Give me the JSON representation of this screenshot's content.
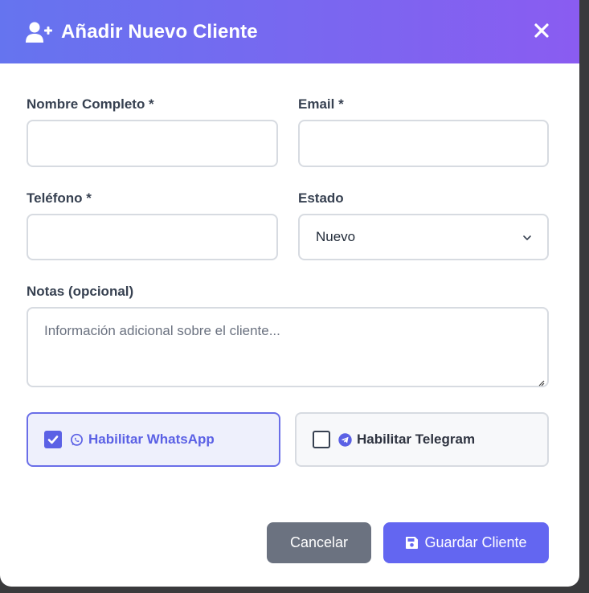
{
  "modal": {
    "title": "Añadir Nuevo Cliente",
    "header_icon": "user-plus-icon",
    "close_icon": "close-icon"
  },
  "form": {
    "name": {
      "label": "Nombre Completo *",
      "value": ""
    },
    "email": {
      "label": "Email *",
      "value": ""
    },
    "phone": {
      "label": "Teléfono *",
      "value": ""
    },
    "status": {
      "label": "Estado",
      "selected": "Nuevo",
      "icon": "chevron-down-icon"
    },
    "notes": {
      "label": "Notas (opcional)",
      "placeholder": "Información adicional sobre el cliente...",
      "value": ""
    }
  },
  "toggles": {
    "whatsapp": {
      "label": "Habilitar WhatsApp",
      "checked": true,
      "icon": "whatsapp-icon"
    },
    "telegram": {
      "label": "Habilitar Telegram",
      "checked": false,
      "icon": "telegram-icon"
    }
  },
  "actions": {
    "cancel_label": "Cancelar",
    "save_label": "Guardar Cliente",
    "save_icon": "save-icon"
  },
  "colors": {
    "header_gradient_start": "#6574ef",
    "header_gradient_end": "#8a5cf1",
    "accent": "#6366f1",
    "cancel": "#6b7280"
  }
}
